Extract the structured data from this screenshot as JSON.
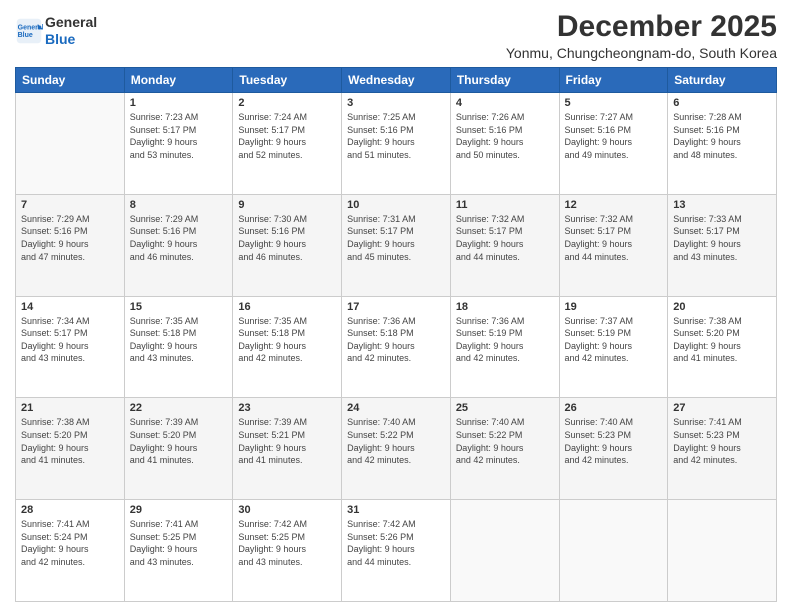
{
  "header": {
    "logo_line1": "General",
    "logo_line2": "Blue",
    "title": "December 2025",
    "subtitle": "Yonmu, Chungcheongnam-do, South Korea"
  },
  "weekdays": [
    "Sunday",
    "Monday",
    "Tuesday",
    "Wednesday",
    "Thursday",
    "Friday",
    "Saturday"
  ],
  "weeks": [
    [
      {
        "day": "",
        "info": ""
      },
      {
        "day": "1",
        "info": "Sunrise: 7:23 AM\nSunset: 5:17 PM\nDaylight: 9 hours\nand 53 minutes."
      },
      {
        "day": "2",
        "info": "Sunrise: 7:24 AM\nSunset: 5:17 PM\nDaylight: 9 hours\nand 52 minutes."
      },
      {
        "day": "3",
        "info": "Sunrise: 7:25 AM\nSunset: 5:16 PM\nDaylight: 9 hours\nand 51 minutes."
      },
      {
        "day": "4",
        "info": "Sunrise: 7:26 AM\nSunset: 5:16 PM\nDaylight: 9 hours\nand 50 minutes."
      },
      {
        "day": "5",
        "info": "Sunrise: 7:27 AM\nSunset: 5:16 PM\nDaylight: 9 hours\nand 49 minutes."
      },
      {
        "day": "6",
        "info": "Sunrise: 7:28 AM\nSunset: 5:16 PM\nDaylight: 9 hours\nand 48 minutes."
      }
    ],
    [
      {
        "day": "7",
        "info": "Sunrise: 7:29 AM\nSunset: 5:16 PM\nDaylight: 9 hours\nand 47 minutes."
      },
      {
        "day": "8",
        "info": "Sunrise: 7:29 AM\nSunset: 5:16 PM\nDaylight: 9 hours\nand 46 minutes."
      },
      {
        "day": "9",
        "info": "Sunrise: 7:30 AM\nSunset: 5:16 PM\nDaylight: 9 hours\nand 46 minutes."
      },
      {
        "day": "10",
        "info": "Sunrise: 7:31 AM\nSunset: 5:17 PM\nDaylight: 9 hours\nand 45 minutes."
      },
      {
        "day": "11",
        "info": "Sunrise: 7:32 AM\nSunset: 5:17 PM\nDaylight: 9 hours\nand 44 minutes."
      },
      {
        "day": "12",
        "info": "Sunrise: 7:32 AM\nSunset: 5:17 PM\nDaylight: 9 hours\nand 44 minutes."
      },
      {
        "day": "13",
        "info": "Sunrise: 7:33 AM\nSunset: 5:17 PM\nDaylight: 9 hours\nand 43 minutes."
      }
    ],
    [
      {
        "day": "14",
        "info": "Sunrise: 7:34 AM\nSunset: 5:17 PM\nDaylight: 9 hours\nand 43 minutes."
      },
      {
        "day": "15",
        "info": "Sunrise: 7:35 AM\nSunset: 5:18 PM\nDaylight: 9 hours\nand 43 minutes."
      },
      {
        "day": "16",
        "info": "Sunrise: 7:35 AM\nSunset: 5:18 PM\nDaylight: 9 hours\nand 42 minutes."
      },
      {
        "day": "17",
        "info": "Sunrise: 7:36 AM\nSunset: 5:18 PM\nDaylight: 9 hours\nand 42 minutes."
      },
      {
        "day": "18",
        "info": "Sunrise: 7:36 AM\nSunset: 5:19 PM\nDaylight: 9 hours\nand 42 minutes."
      },
      {
        "day": "19",
        "info": "Sunrise: 7:37 AM\nSunset: 5:19 PM\nDaylight: 9 hours\nand 42 minutes."
      },
      {
        "day": "20",
        "info": "Sunrise: 7:38 AM\nSunset: 5:20 PM\nDaylight: 9 hours\nand 41 minutes."
      }
    ],
    [
      {
        "day": "21",
        "info": "Sunrise: 7:38 AM\nSunset: 5:20 PM\nDaylight: 9 hours\nand 41 minutes."
      },
      {
        "day": "22",
        "info": "Sunrise: 7:39 AM\nSunset: 5:20 PM\nDaylight: 9 hours\nand 41 minutes."
      },
      {
        "day": "23",
        "info": "Sunrise: 7:39 AM\nSunset: 5:21 PM\nDaylight: 9 hours\nand 41 minutes."
      },
      {
        "day": "24",
        "info": "Sunrise: 7:40 AM\nSunset: 5:22 PM\nDaylight: 9 hours\nand 42 minutes."
      },
      {
        "day": "25",
        "info": "Sunrise: 7:40 AM\nSunset: 5:22 PM\nDaylight: 9 hours\nand 42 minutes."
      },
      {
        "day": "26",
        "info": "Sunrise: 7:40 AM\nSunset: 5:23 PM\nDaylight: 9 hours\nand 42 minutes."
      },
      {
        "day": "27",
        "info": "Sunrise: 7:41 AM\nSunset: 5:23 PM\nDaylight: 9 hours\nand 42 minutes."
      }
    ],
    [
      {
        "day": "28",
        "info": "Sunrise: 7:41 AM\nSunset: 5:24 PM\nDaylight: 9 hours\nand 42 minutes."
      },
      {
        "day": "29",
        "info": "Sunrise: 7:41 AM\nSunset: 5:25 PM\nDaylight: 9 hours\nand 43 minutes."
      },
      {
        "day": "30",
        "info": "Sunrise: 7:42 AM\nSunset: 5:25 PM\nDaylight: 9 hours\nand 43 minutes."
      },
      {
        "day": "31",
        "info": "Sunrise: 7:42 AM\nSunset: 5:26 PM\nDaylight: 9 hours\nand 44 minutes."
      },
      {
        "day": "",
        "info": ""
      },
      {
        "day": "",
        "info": ""
      },
      {
        "day": "",
        "info": ""
      }
    ]
  ]
}
